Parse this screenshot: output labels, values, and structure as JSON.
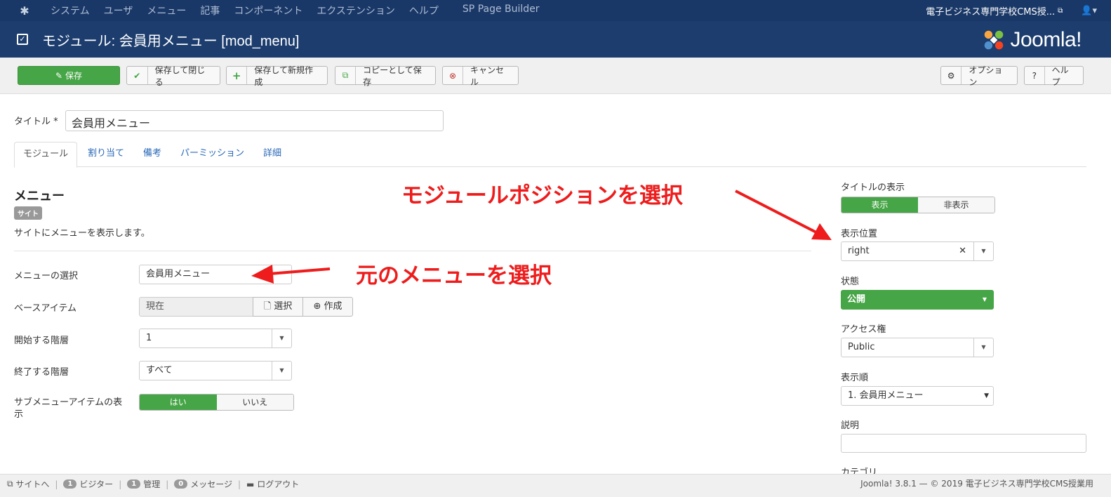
{
  "topnav": {
    "menu": [
      "システム",
      "ユーザ",
      "メニュー",
      "記事",
      "コンポーネント",
      "エクステンション",
      "ヘルプ",
      "SP Page Builder"
    ],
    "site_name": "電子ビジネス専門学校CMS授..."
  },
  "header": {
    "title": "モジュール: 会員用メニュー [mod_menu]",
    "brand": "Joomla!"
  },
  "toolbar": {
    "save": "保存",
    "save_close": "保存して閉じる",
    "save_new": "保存して新規作成",
    "save_copy": "コピーとして保存",
    "cancel": "キャンセル",
    "options": "オプション",
    "help": "ヘルプ"
  },
  "form": {
    "title_label": "タイトル *",
    "title_value": "会員用メニュー",
    "tabs": [
      "モジュール",
      "割り当て",
      "備考",
      "パーミッション",
      "詳細"
    ],
    "section_title": "メニュー",
    "badge": "サイト",
    "description": "サイトにメニューを表示します。",
    "fields": {
      "menu_select": {
        "label": "メニューの選択",
        "value": "会員用メニュー"
      },
      "base_item": {
        "label": "ベースアイテム",
        "value": "現在",
        "select_btn": "選択",
        "create_btn": "作成"
      },
      "start_level": {
        "label": "開始する階層",
        "value": "1"
      },
      "end_level": {
        "label": "終了する階層",
        "value": "すべて"
      },
      "show_sub": {
        "label": "サブメニューアイテムの表示",
        "yes": "はい",
        "no": "いいえ"
      }
    }
  },
  "sidebar": {
    "show_title": {
      "label": "タイトルの表示",
      "on": "表示",
      "off": "非表示"
    },
    "position": {
      "label": "表示位置",
      "value": "right"
    },
    "status": {
      "label": "状態",
      "value": "公開"
    },
    "access": {
      "label": "アクセス権",
      "value": "Public"
    },
    "ordering": {
      "label": "表示順",
      "value": "1. 会員用メニュー"
    },
    "note": {
      "label": "説明",
      "value": ""
    },
    "category": {
      "label": "カテゴリ"
    }
  },
  "annotations": {
    "position_note": "モジュールポジションを選択",
    "menu_note": "元のメニューを選択"
  },
  "statusbar": {
    "site": "サイトへ",
    "visitors_count": "1",
    "visitors": "ビジター",
    "admins_count": "1",
    "admins": "管理",
    "messages_count": "0",
    "messages": "メッセージ",
    "logout": "ログアウト",
    "copyright": "Joomla! 3.8.1 — © 2019 電子ビジネス専門学校CMS授業用"
  },
  "colors": {
    "nav": "#1a3867",
    "header": "#1c3d6e",
    "green": "#46a546",
    "annotation": "#ee1c1c",
    "link": "#2a69b8"
  }
}
